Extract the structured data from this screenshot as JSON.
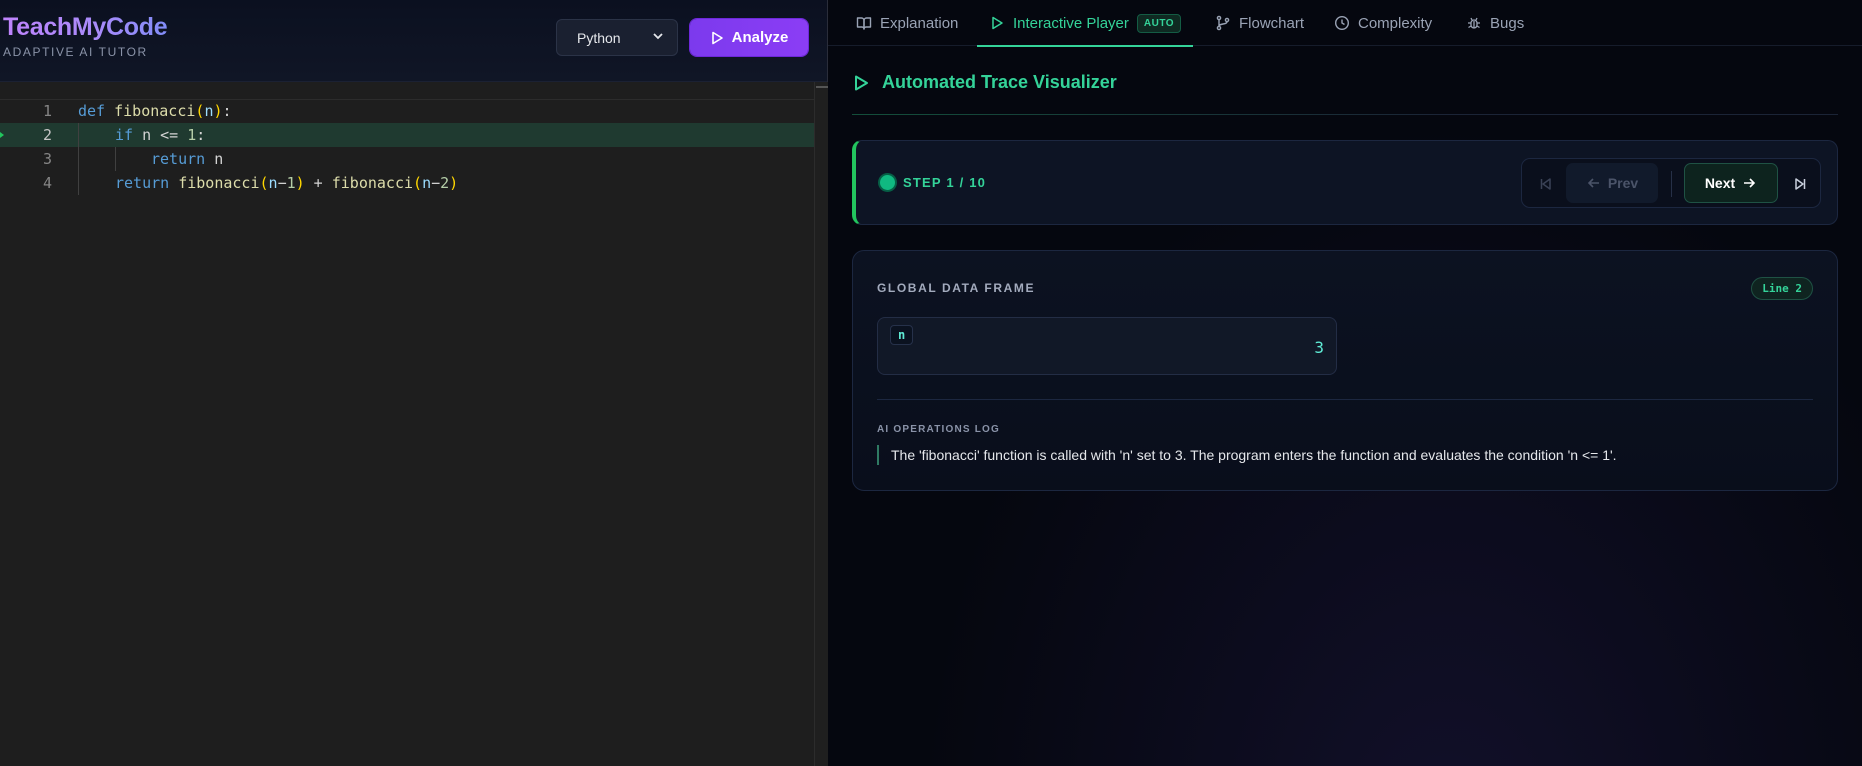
{
  "brand": {
    "title": "TeachMyCode",
    "subtitle": "ADAPTIVE AI TUTOR"
  },
  "toolbar": {
    "language": "Python",
    "analyze_label": "Analyze"
  },
  "editor": {
    "lines": [
      {
        "number": "1"
      },
      {
        "number": "2"
      },
      {
        "number": "3"
      },
      {
        "number": "4"
      }
    ],
    "tokens": {
      "l1_def": "def",
      "l1_fn": "fibonacci",
      "l1_open": "(",
      "l1_arg": "n",
      "l1_close": ")",
      "l1_colon": ":",
      "l2_if": "if",
      "l2_rest": " n <= ",
      "l2_num": "1",
      "l2_colon": ":",
      "l3_return": "return",
      "l3_rest": " n",
      "l4_return": "return",
      "l4_fn1": "fibonacci",
      "l4_open1": "(",
      "l4_arg1": "n",
      "l4_op1": "−",
      "l4_num1": "1",
      "l4_close1": ")",
      "l4_plus": " + ",
      "l4_fn2": "fibonacci",
      "l4_open2": "(",
      "l4_arg2": "n",
      "l4_op2": "−",
      "l4_num2": "2",
      "l4_close2": ")"
    },
    "active_line": 2
  },
  "tabs": [
    {
      "label": "Explanation",
      "icon": "book-icon"
    },
    {
      "label": "Interactive Player",
      "icon": "play-icon",
      "badge": "AUTO",
      "active": true
    },
    {
      "label": "Flowchart",
      "icon": "git-branch-icon"
    },
    {
      "label": "Complexity",
      "icon": "clock-icon"
    },
    {
      "label": "Bugs",
      "icon": "bug-icon"
    }
  ],
  "player": {
    "title": "Automated Trace Visualizer",
    "step_label": "STEP 1 / 10",
    "prev_label": "Prev",
    "next_label": "Next"
  },
  "frame": {
    "title": "GLOBAL DATA FRAME",
    "line_badge": "Line 2",
    "variables": [
      {
        "name": "n",
        "value": "3"
      }
    ],
    "log_title": "AI OPERATIONS LOG",
    "log_text": "The 'fibonacci' function is called with 'n' set to 3. The program enters the function and evaluates the condition 'n <= 1'."
  },
  "colors": {
    "accent": "#34d399",
    "brand": "#8b5cf6",
    "editor_bg": "#1e1e1e",
    "active_line_bg": "#1f3a30"
  }
}
